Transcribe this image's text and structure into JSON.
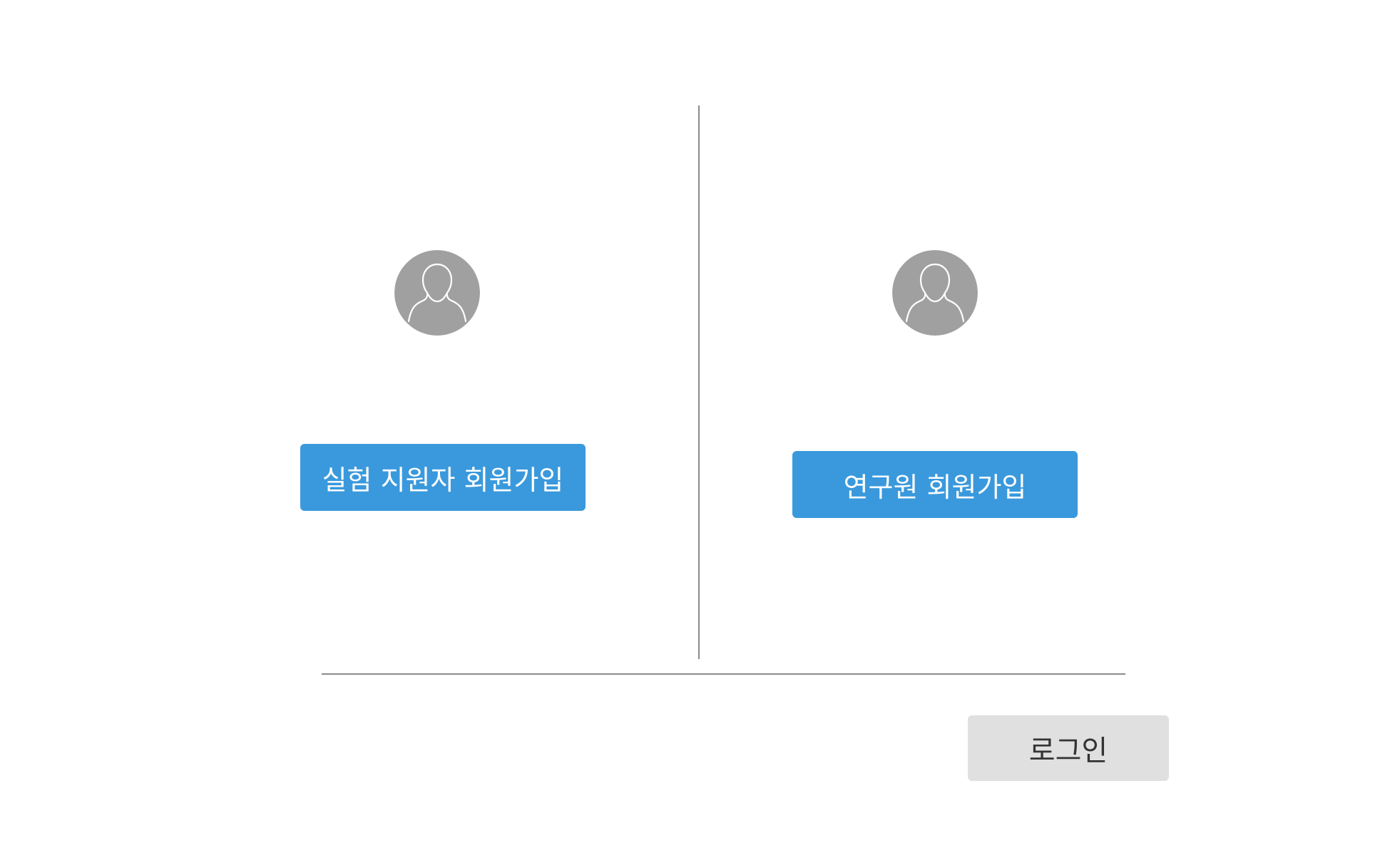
{
  "colors": {
    "primary_button": "#3a99dc",
    "primary_button_text": "#ffffff",
    "secondary_button": "#e0e0e0",
    "secondary_button_text": "#333333",
    "avatar_bg": "#a0a0a0",
    "avatar_outline": "#ffffff",
    "divider": "#8a8a8a"
  },
  "left_panel": {
    "avatar_icon": "user-silhouette-icon",
    "button_label": "실험 지원자 회원가입"
  },
  "right_panel": {
    "avatar_icon": "user-silhouette-icon",
    "button_label": "연구원 회원가입"
  },
  "footer": {
    "login_label": "로그인"
  }
}
